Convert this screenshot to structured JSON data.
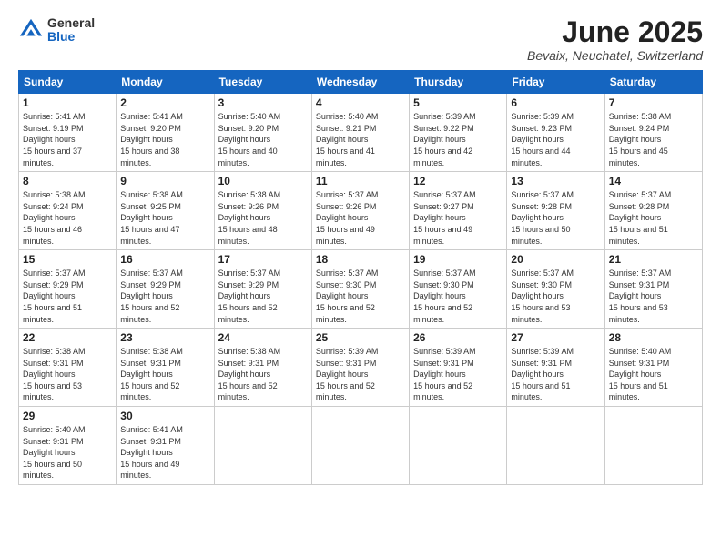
{
  "logo": {
    "general": "General",
    "blue": "Blue"
  },
  "title": "June 2025",
  "location": "Bevaix, Neuchatel, Switzerland",
  "days_header": [
    "Sunday",
    "Monday",
    "Tuesday",
    "Wednesday",
    "Thursday",
    "Friday",
    "Saturday"
  ],
  "weeks": [
    [
      {
        "day": "1",
        "sunrise": "5:41 AM",
        "sunset": "9:19 PM",
        "daylight": "15 hours and 37 minutes."
      },
      {
        "day": "2",
        "sunrise": "5:41 AM",
        "sunset": "9:20 PM",
        "daylight": "15 hours and 38 minutes."
      },
      {
        "day": "3",
        "sunrise": "5:40 AM",
        "sunset": "9:20 PM",
        "daylight": "15 hours and 40 minutes."
      },
      {
        "day": "4",
        "sunrise": "5:40 AM",
        "sunset": "9:21 PM",
        "daylight": "15 hours and 41 minutes."
      },
      {
        "day": "5",
        "sunrise": "5:39 AM",
        "sunset": "9:22 PM",
        "daylight": "15 hours and 42 minutes."
      },
      {
        "day": "6",
        "sunrise": "5:39 AM",
        "sunset": "9:23 PM",
        "daylight": "15 hours and 44 minutes."
      },
      {
        "day": "7",
        "sunrise": "5:38 AM",
        "sunset": "9:24 PM",
        "daylight": "15 hours and 45 minutes."
      }
    ],
    [
      {
        "day": "8",
        "sunrise": "5:38 AM",
        "sunset": "9:24 PM",
        "daylight": "15 hours and 46 minutes."
      },
      {
        "day": "9",
        "sunrise": "5:38 AM",
        "sunset": "9:25 PM",
        "daylight": "15 hours and 47 minutes."
      },
      {
        "day": "10",
        "sunrise": "5:38 AM",
        "sunset": "9:26 PM",
        "daylight": "15 hours and 48 minutes."
      },
      {
        "day": "11",
        "sunrise": "5:37 AM",
        "sunset": "9:26 PM",
        "daylight": "15 hours and 49 minutes."
      },
      {
        "day": "12",
        "sunrise": "5:37 AM",
        "sunset": "9:27 PM",
        "daylight": "15 hours and 49 minutes."
      },
      {
        "day": "13",
        "sunrise": "5:37 AM",
        "sunset": "9:28 PM",
        "daylight": "15 hours and 50 minutes."
      },
      {
        "day": "14",
        "sunrise": "5:37 AM",
        "sunset": "9:28 PM",
        "daylight": "15 hours and 51 minutes."
      }
    ],
    [
      {
        "day": "15",
        "sunrise": "5:37 AM",
        "sunset": "9:29 PM",
        "daylight": "15 hours and 51 minutes."
      },
      {
        "day": "16",
        "sunrise": "5:37 AM",
        "sunset": "9:29 PM",
        "daylight": "15 hours and 52 minutes."
      },
      {
        "day": "17",
        "sunrise": "5:37 AM",
        "sunset": "9:29 PM",
        "daylight": "15 hours and 52 minutes."
      },
      {
        "day": "18",
        "sunrise": "5:37 AM",
        "sunset": "9:30 PM",
        "daylight": "15 hours and 52 minutes."
      },
      {
        "day": "19",
        "sunrise": "5:37 AM",
        "sunset": "9:30 PM",
        "daylight": "15 hours and 52 minutes."
      },
      {
        "day": "20",
        "sunrise": "5:37 AM",
        "sunset": "9:30 PM",
        "daylight": "15 hours and 53 minutes."
      },
      {
        "day": "21",
        "sunrise": "5:37 AM",
        "sunset": "9:31 PM",
        "daylight": "15 hours and 53 minutes."
      }
    ],
    [
      {
        "day": "22",
        "sunrise": "5:38 AM",
        "sunset": "9:31 PM",
        "daylight": "15 hours and 53 minutes."
      },
      {
        "day": "23",
        "sunrise": "5:38 AM",
        "sunset": "9:31 PM",
        "daylight": "15 hours and 52 minutes."
      },
      {
        "day": "24",
        "sunrise": "5:38 AM",
        "sunset": "9:31 PM",
        "daylight": "15 hours and 52 minutes."
      },
      {
        "day": "25",
        "sunrise": "5:39 AM",
        "sunset": "9:31 PM",
        "daylight": "15 hours and 52 minutes."
      },
      {
        "day": "26",
        "sunrise": "5:39 AM",
        "sunset": "9:31 PM",
        "daylight": "15 hours and 52 minutes."
      },
      {
        "day": "27",
        "sunrise": "5:39 AM",
        "sunset": "9:31 PM",
        "daylight": "15 hours and 51 minutes."
      },
      {
        "day": "28",
        "sunrise": "5:40 AM",
        "sunset": "9:31 PM",
        "daylight": "15 hours and 51 minutes."
      }
    ],
    [
      {
        "day": "29",
        "sunrise": "5:40 AM",
        "sunset": "9:31 PM",
        "daylight": "15 hours and 50 minutes."
      },
      {
        "day": "30",
        "sunrise": "5:41 AM",
        "sunset": "9:31 PM",
        "daylight": "15 hours and 49 minutes."
      },
      null,
      null,
      null,
      null,
      null
    ]
  ]
}
